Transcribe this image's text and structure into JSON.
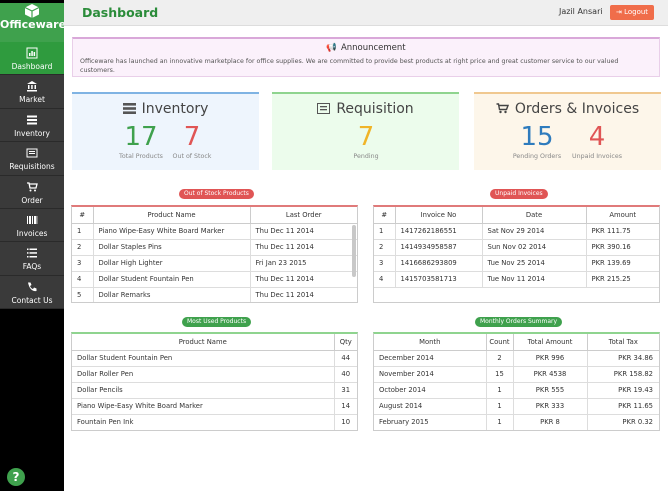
{
  "brand": {
    "name": "Officeware",
    "icon": "cube-icon"
  },
  "nav": [
    {
      "label": "Dashboard",
      "icon": "bar-chart-icon",
      "active": true
    },
    {
      "label": "Market",
      "icon": "bank-icon"
    },
    {
      "label": "Inventory",
      "icon": "tasks-icon"
    },
    {
      "label": "Requisitions",
      "icon": "list-alt-icon"
    },
    {
      "label": "Order",
      "icon": "cart-icon"
    },
    {
      "label": "Invoices",
      "icon": "barcode-icon"
    },
    {
      "label": "FAQs",
      "icon": "list-icon"
    },
    {
      "label": "Contact Us",
      "icon": "phone-icon"
    }
  ],
  "help": "?",
  "header": {
    "title": "Dashboard",
    "user": "Jazil Ansari",
    "logout": "Logout"
  },
  "announcement": {
    "title": "Announcement",
    "text": "Officeware has launched an innovative marketplace for office supplies. We are committed to provide best products at right price and great customer service to our valued customers."
  },
  "cards": {
    "inventory": {
      "title": "Inventory",
      "a": "17",
      "a_label": "Total Products",
      "b": "7",
      "b_label": "Out of Stock",
      "color": "#5b9bd5"
    },
    "requisition": {
      "title": "Requisition",
      "a": "7",
      "a_label": "Pending",
      "color": "#3fa14d"
    },
    "orders": {
      "title": "Orders & Invoices",
      "a": "15",
      "a_label": "Pending Orders",
      "b": "4",
      "b_label": "Unpaid Invoices",
      "color": "#f0a050"
    }
  },
  "out_of_stock": {
    "label": "Out of Stock Products",
    "headers": [
      "#",
      "Product Name",
      "Last Order"
    ],
    "rows": [
      [
        "1",
        "Piano Wipe-Easy White Board Marker",
        "Thu Dec 11 2014"
      ],
      [
        "2",
        "Dollar Staples Pins",
        "Thu Dec 11 2014"
      ],
      [
        "3",
        "Dollar High Lighter",
        "Fri Jan 23 2015"
      ],
      [
        "4",
        "Dollar Student Fountain Pen",
        "Thu Dec 11 2014"
      ],
      [
        "5",
        "Dollar Remarks",
        "Thu Dec 11 2014"
      ]
    ]
  },
  "unpaid": {
    "label": "Unpaid Invoices",
    "headers": [
      "#",
      "Invoice No",
      "Date",
      "Amount"
    ],
    "rows": [
      [
        "1",
        "1417262186551",
        "Sat Nov 29 2014",
        "PKR 111.75"
      ],
      [
        "2",
        "1414934958587",
        "Sun Nov 02 2014",
        "PKR 390.16"
      ],
      [
        "3",
        "1416686293809",
        "Tue Nov 25 2014",
        "PKR 139.69"
      ],
      [
        "4",
        "1415703581713",
        "Tue Nov 11 2014",
        "PKR 215.25"
      ]
    ]
  },
  "most_used": {
    "label": "Most Used Products",
    "headers": [
      "Product Name",
      "Qty"
    ],
    "rows": [
      [
        "Dollar Student Fountain Pen",
        "44"
      ],
      [
        "Dollar Roller Pen",
        "40"
      ],
      [
        "Dollar Pencils",
        "31"
      ],
      [
        "Piano Wipe-Easy White Board Marker",
        "14"
      ],
      [
        "Fountain Pen Ink",
        "10"
      ]
    ]
  },
  "monthly": {
    "label": "Monthly Orders Summary",
    "headers": [
      "Month",
      "Count",
      "Total Amount",
      "Total Tax"
    ],
    "rows": [
      [
        "December 2014",
        "2",
        "PKR 996",
        "PKR 34.86"
      ],
      [
        "November 2014",
        "15",
        "PKR 4538",
        "PKR 158.82"
      ],
      [
        "October 2014",
        "1",
        "PKR 555",
        "PKR 19.43"
      ],
      [
        "August 2014",
        "1",
        "PKR 333",
        "PKR 11.65"
      ],
      [
        "February 2015",
        "1",
        "PKR 8",
        "PKR 0.32"
      ]
    ]
  },
  "colors": {
    "green": "#3fa14d",
    "red": "#e05555",
    "accent": "#f06d4a"
  }
}
